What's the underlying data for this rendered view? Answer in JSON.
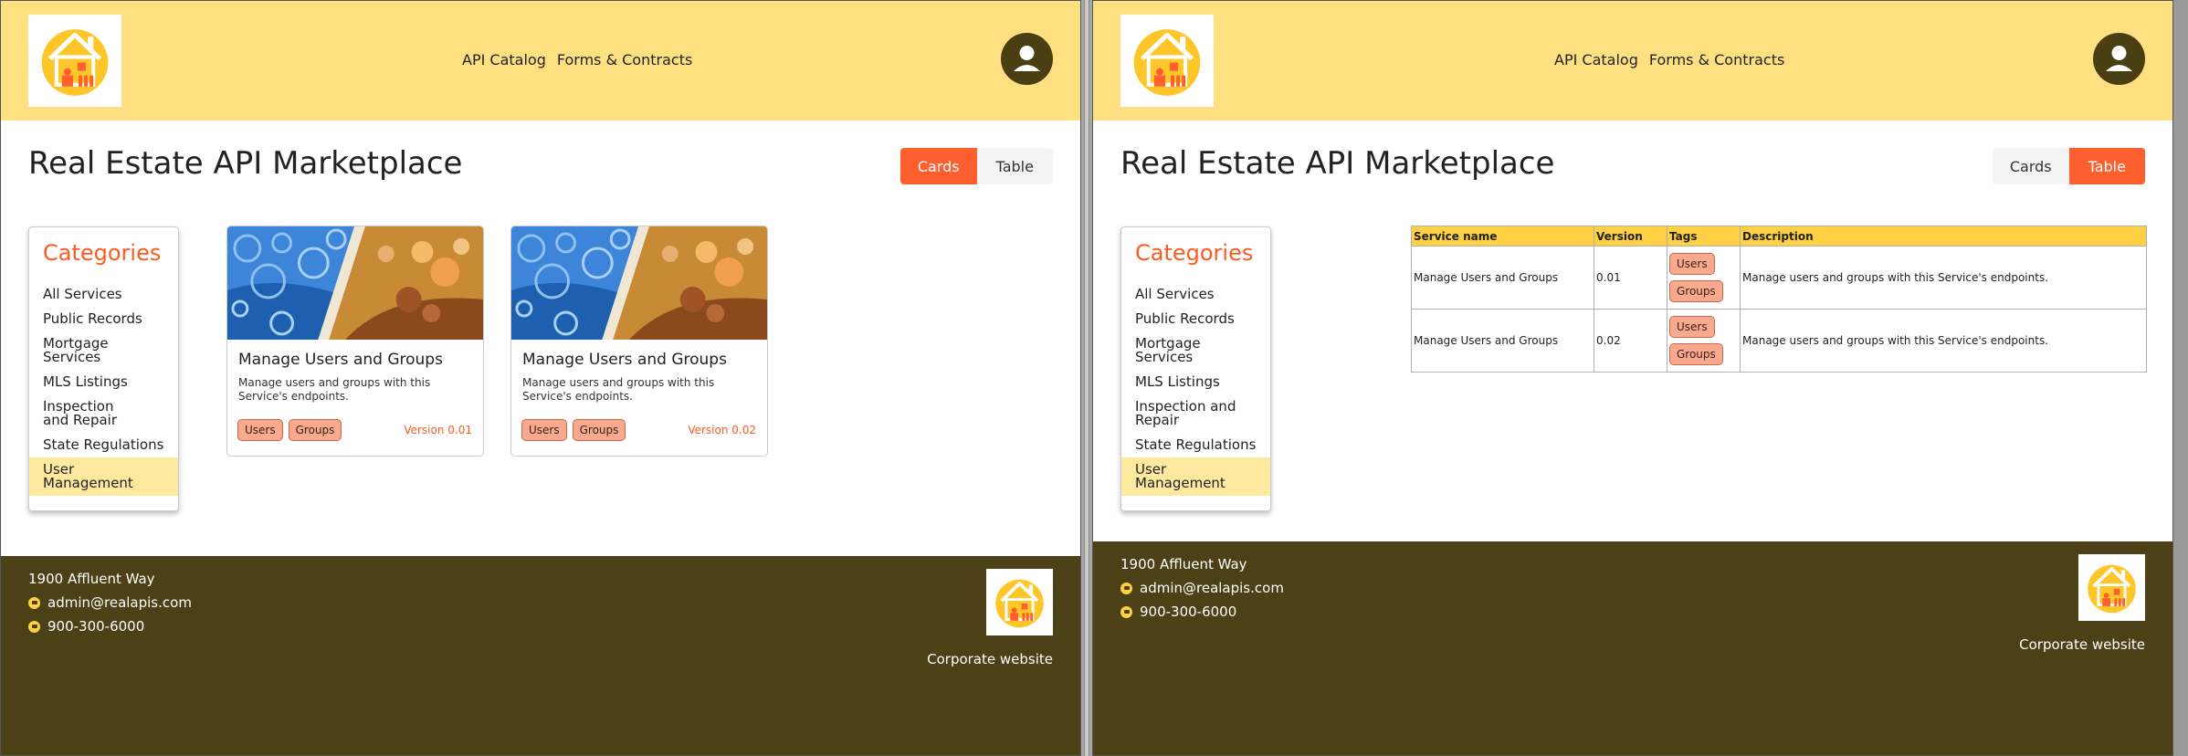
{
  "nav": {
    "api_catalog": "API Catalog",
    "forms_contracts": "Forms & Contracts"
  },
  "page_title": "Real Estate API Marketplace",
  "view_toggle": {
    "cards": "Cards",
    "table": "Table"
  },
  "left_view": {
    "active": "Cards"
  },
  "right_view": {
    "active": "Table"
  },
  "categories": {
    "title": "Categories",
    "items": [
      "All Services",
      "Public Records",
      "Mortgage Services",
      "MLS Listings",
      "Inspection and Repair",
      "State Regulations",
      "User Management"
    ],
    "selected": "User Management"
  },
  "services": [
    {
      "name": "Manage Users and Groups",
      "description": "Manage users and groups with this Service's endpoints.",
      "version": "0.01",
      "version_label": "Version 0.01",
      "tags": [
        "Users",
        "Groups"
      ]
    },
    {
      "name": "Manage Users and Groups",
      "description": "Manage users and groups with this Service's endpoints.",
      "version": "0.02",
      "version_label": "Version 0.02",
      "tags": [
        "Users",
        "Groups"
      ]
    }
  ],
  "table": {
    "headers": {
      "name": "Service name",
      "version": "Version",
      "tags": "Tags",
      "description": "Description"
    }
  },
  "footer": {
    "address": "1900 Affluent Way",
    "email": "admin@realapis.com",
    "phone": "900-300-6000",
    "corporate_link": "Corporate website"
  },
  "icons": {
    "logo": "house-logo-icon",
    "avatar": "user-avatar-icon",
    "email": "email-icon",
    "phone": "phone-icon"
  },
  "colors": {
    "header": "#ffe081",
    "accent": "#ff5f2e",
    "footer": "#4c4116",
    "tag": "#f9a98e",
    "selected_category": "#ffe99e"
  }
}
